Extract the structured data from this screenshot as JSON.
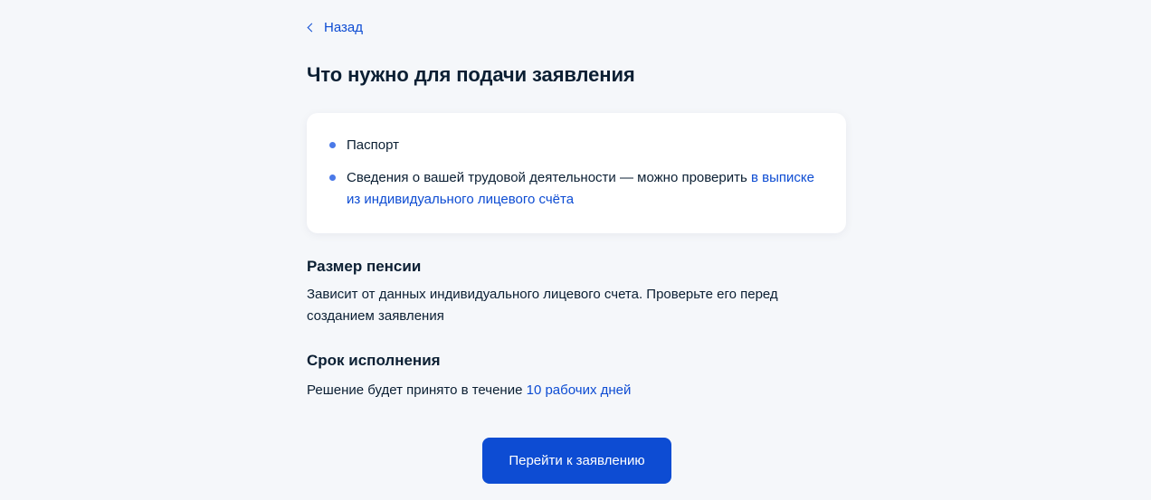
{
  "nav": {
    "back_label": "Назад"
  },
  "title": "Что нужно для подачи заявления",
  "requirements": {
    "items": [
      {
        "text": "Паспорт"
      },
      {
        "text": "Сведения о вашей трудовой деятельности — можно проверить ",
        "link": "в выписке из индивидуального лицевого счёта"
      }
    ]
  },
  "pension_size": {
    "heading": "Размер пенсии",
    "text": "Зависит от данных индивидуального лицевого счета. Проверьте его перед созданием заявления"
  },
  "deadline": {
    "heading": "Срок исполнения",
    "text": "Решение будет принято в течение ",
    "link": "10 рабочих дней"
  },
  "cta": {
    "label": "Перейти к заявлению"
  },
  "colors": {
    "accent": "#0d4cd3",
    "background": "#f5f7fa",
    "text": "#0b1f33",
    "bullet": "#4a79e8"
  },
  "icons": {
    "back": "chevron-left-icon",
    "bullet": "bullet-dot-icon"
  }
}
